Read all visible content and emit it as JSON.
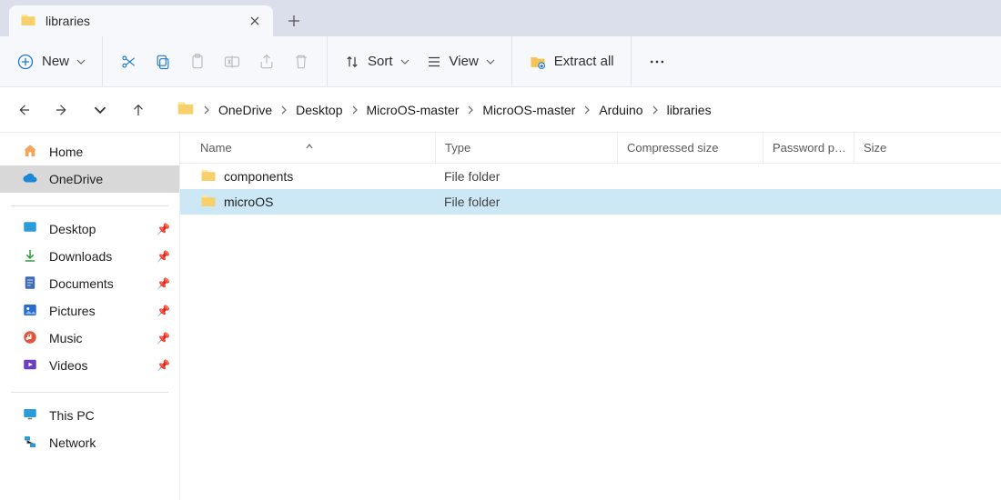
{
  "tab": {
    "title": "libraries"
  },
  "toolbar": {
    "new_label": "New",
    "sort_label": "Sort",
    "view_label": "View",
    "extract_label": "Extract all"
  },
  "breadcrumb": {
    "segments": [
      "OneDrive",
      "Desktop",
      "MicroOS-master",
      "MicroOS-master",
      "Arduino",
      "libraries"
    ]
  },
  "sidebar": {
    "home": "Home",
    "onedrive": "OneDrive",
    "quick": [
      {
        "label": "Desktop"
      },
      {
        "label": "Downloads"
      },
      {
        "label": "Documents"
      },
      {
        "label": "Pictures"
      },
      {
        "label": "Music"
      },
      {
        "label": "Videos"
      }
    ],
    "thispc": "This PC",
    "network": "Network"
  },
  "columns": {
    "name": "Name",
    "type": "Type",
    "compressed_size": "Compressed size",
    "password_protected": "Password p…",
    "size": "Size"
  },
  "files": [
    {
      "name": "components",
      "type": "File folder",
      "csize": "",
      "pw": "",
      "size": "",
      "selected": false
    },
    {
      "name": "microOS",
      "type": "File folder",
      "csize": "",
      "pw": "",
      "size": "",
      "selected": true
    }
  ]
}
